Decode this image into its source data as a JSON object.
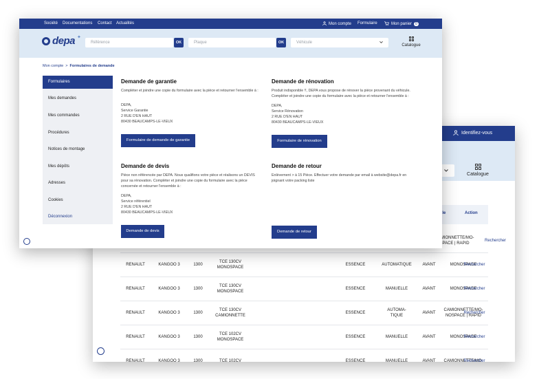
{
  "back_window": {
    "account_label": "Identifiez-vous",
    "catalogue_label": "Catalogue",
    "table": {
      "headers": {
        "vehicule": "hicule",
        "action": "Action"
      },
      "first_row": {
        "type": "CAMIONNETTE/MO-\nSPACE | RAPID",
        "action": "Rechercher"
      },
      "rows": [
        {
          "marque": "RENAULT",
          "modele": "KANGOO 3",
          "cyl": "1300",
          "moteur": "TCE 130CV\nMONOSPACE",
          "carbu": "ESSENCE",
          "boite": "AUTOMATIQUE",
          "trans": "AVANT",
          "type": "MONOSPACE",
          "action": "Rechercher"
        },
        {
          "marque": "RENAULT",
          "modele": "KANGOO 3",
          "cyl": "1300",
          "moteur": "TCE 130CV\nMONOSPACE",
          "carbu": "ESSENCE",
          "boite": "MANUELLE",
          "trans": "AVANT",
          "type": "MONOSPACE",
          "action": "Rechercher"
        },
        {
          "marque": "RENAULT",
          "modele": "KANGOO 3",
          "cyl": "1300",
          "moteur": "TCE 130CV\nCAMIONNETTE",
          "carbu": "ESSENCE",
          "boite": "AUTOMA-\nTIQUE",
          "trans": "AVANT",
          "type": "CAMIONNETTE/MO-\nNOSPACE | RAPID",
          "action": "Rechercher"
        },
        {
          "marque": "RENAULT",
          "modele": "KANGOO 3",
          "cyl": "1300",
          "moteur": "TCE 102CV\nMONOSPACE",
          "carbu": "ESSENCE",
          "boite": "MANUELLE",
          "trans": "AVANT",
          "type": "MONOSPACE",
          "action": "Rechercher"
        },
        {
          "marque": "RENAULT",
          "modele": "KANGOO 3",
          "cyl": "1300",
          "moteur": "TCE 102CV",
          "carbu": "ESSENCE",
          "boite": "MANUELLE",
          "trans": "AVANT",
          "type": "CAMIONNETTE/MO-",
          "action": "Rechercher"
        }
      ]
    }
  },
  "front_window": {
    "topbar": {
      "links": [
        "Société",
        "Documentations",
        "Contact",
        "Actualités"
      ],
      "account": "Mon compte",
      "formulaire": "Formulaire",
      "cart": "Mon panier",
      "cart_count": "0"
    },
    "search": {
      "logo": "depa",
      "reference_placeholder": "Référence",
      "plaque_placeholder": "Plaque",
      "vehicule_placeholder": "Véhicule",
      "ok_label": "OK",
      "catalogue_label": "Catalogue"
    },
    "breadcrumb": {
      "parent": "Mon compte",
      "separator": ">",
      "current": "Formulaires de demande"
    },
    "sidebar": {
      "items": [
        "Formulaires",
        "Mes demandes",
        "Mes commandes",
        "Procédures",
        "Notices de montage",
        "Mes dépôts",
        "Adresses",
        "Cookies",
        "Déconnexion"
      ]
    },
    "sections": {
      "garantie": {
        "title": "Demande de garantie",
        "desc": "Compléter et joindre une copie du formulaire avec la pièce et retourner l'ensemble à :",
        "address": [
          "DEPA,",
          "Service Garantie",
          "2 RUE D'EN HAUT",
          "80430 BEAUCAMPS-LE-VIEUX"
        ],
        "button": "Formulaire de demande de garantie"
      },
      "renovation": {
        "title": "Demande de rénovation",
        "desc": "Produit indisponible !!, DEPA vous propose de rénover la pièce provenant du véhicule. Compléter et joindre une copie du formulaire avec la pièce et retourner l'ensemble à :",
        "address": [
          "DEPA,",
          "Service Rénovation",
          "2 RUE D'EN HAUT",
          "80430 BEAUCAMPS-LE-VIEUX"
        ],
        "button": "Formulaire de rénovation"
      },
      "devis": {
        "title": "Demande de devis",
        "desc": "Pièce non référencée par DEPA. Nous qualifions votre pièce et réalisons un DEVIS pour sa rénovation. Compléter et joindre une copie du formulaire avec la pièce concernée et retourner l'ensemble à :",
        "address": [
          "DEPA,",
          "Service référentiel",
          "2 RUE D'EN HAUT",
          "80430 BEAUCAMPS-LE-VIEUX"
        ],
        "button": "Demande de devis"
      },
      "retour": {
        "title": "Demande de retour",
        "desc": "Enlèvement > à 15 Pièce. Effectuer votre demande par email à website@depa.fr en joignant votre packing liste",
        "button": "Demande de retour"
      }
    }
  }
}
